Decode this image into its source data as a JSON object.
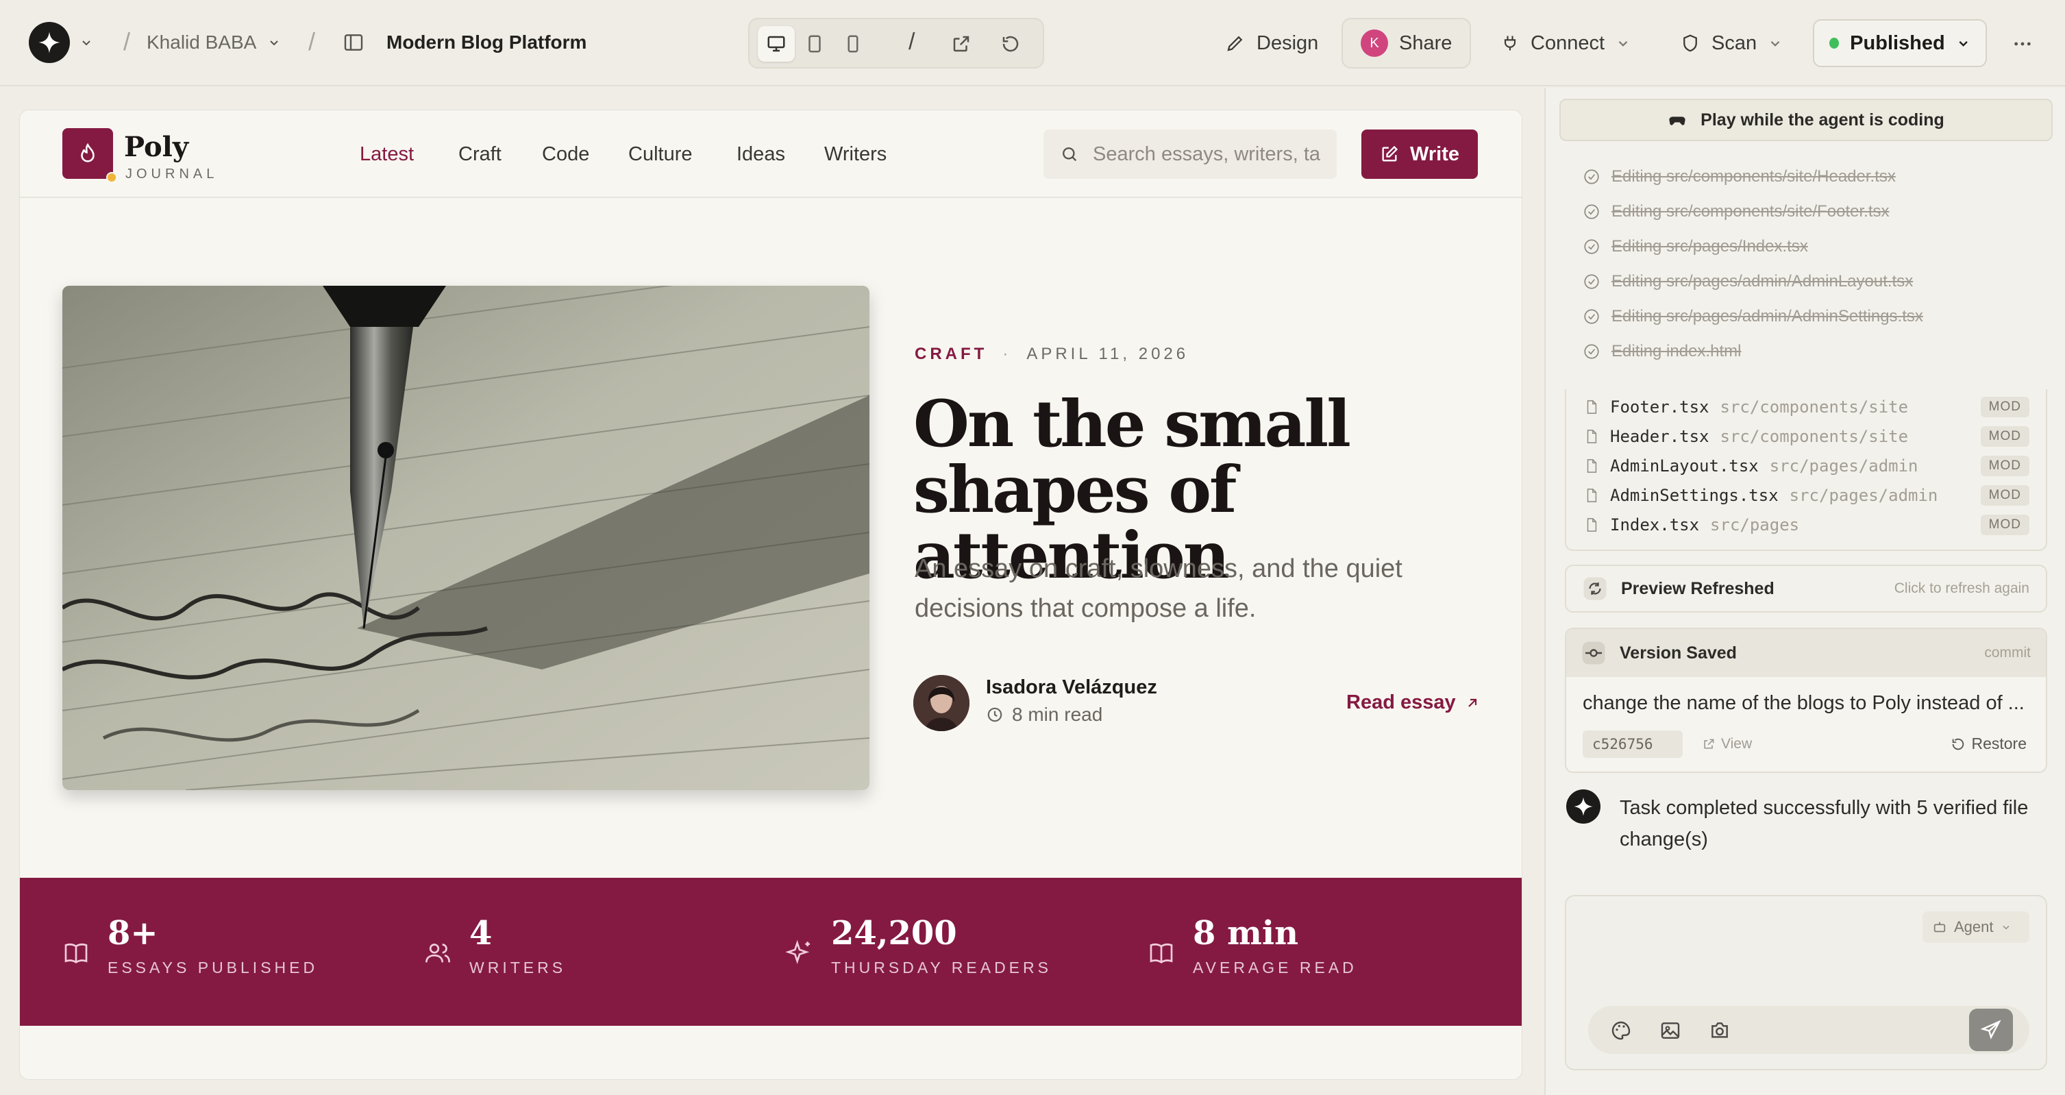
{
  "topbar": {
    "user_name": "Khalid BABA",
    "project_name": "Modern Blog Platform",
    "path_sep": "/",
    "design_label": "Design",
    "share_label": "Share",
    "share_avatar_initial": "K",
    "connect_label": "Connect",
    "scan_label": "Scan",
    "published_label": "Published"
  },
  "site": {
    "brand_name": "Poly",
    "brand_sub": "JOURNAL",
    "nav": [
      "Latest",
      "Craft",
      "Code",
      "Culture",
      "Ideas",
      "Writers"
    ],
    "active_nav": "Latest",
    "search_placeholder": "Search essays, writers, ta",
    "write_label": "Write",
    "hero": {
      "category": "CRAFT",
      "dot": "·",
      "date": "APRIL 11, 2026",
      "title": "On the small shapes of attention",
      "subtitle": "An essay on craft, slowness, and the quiet decisions that compose a life.",
      "author": "Isadora Velázquez",
      "read_time": "8 min read",
      "cta": "Read essay"
    },
    "stats": [
      {
        "value": "8+",
        "label": "ESSAYS PUBLISHED",
        "icon": "book-icon"
      },
      {
        "value": "4",
        "label": "WRITERS",
        "icon": "users-icon"
      },
      {
        "value": "24,200",
        "label": "THURSDAY READERS",
        "icon": "sparkle-icon"
      },
      {
        "value": "8 min",
        "label": "AVERAGE READ",
        "icon": "book-open-icon"
      }
    ]
  },
  "panel": {
    "play_label": "Play while the agent is coding",
    "tasks": [
      "Editing src/components/site/Header.tsx",
      "Editing src/components/site/Footer.tsx",
      "Editing src/pages/Index.tsx",
      "Editing src/pages/admin/AdminLayout.tsx",
      "Editing src/pages/admin/AdminSettings.tsx",
      "Editing index.html"
    ],
    "files": [
      {
        "name": "Footer.tsx",
        "path": "src/components/site",
        "badge": "MOD"
      },
      {
        "name": "Header.tsx",
        "path": "src/components/site",
        "badge": "MOD"
      },
      {
        "name": "AdminLayout.tsx",
        "path": "src/pages/admin",
        "badge": "MOD"
      },
      {
        "name": "AdminSettings.tsx",
        "path": "src/pages/admin",
        "badge": "MOD"
      },
      {
        "name": "Index.tsx",
        "path": "src/pages",
        "badge": "MOD"
      }
    ],
    "refresh_title": "Preview Refreshed",
    "refresh_hint": "Click to refresh again",
    "version_title": "Version Saved",
    "version_hint": "commit",
    "version_message": "change the name of the blogs to Poly instead of ...",
    "commit_hash": "c526756",
    "view_label": "View",
    "restore_label": "Restore",
    "agent_message": "Task completed successfully with 5 verified file change(s)",
    "mode_label": "Agent"
  },
  "colors": {
    "brand": "#841a42",
    "published_dot": "#3fbf5c"
  }
}
